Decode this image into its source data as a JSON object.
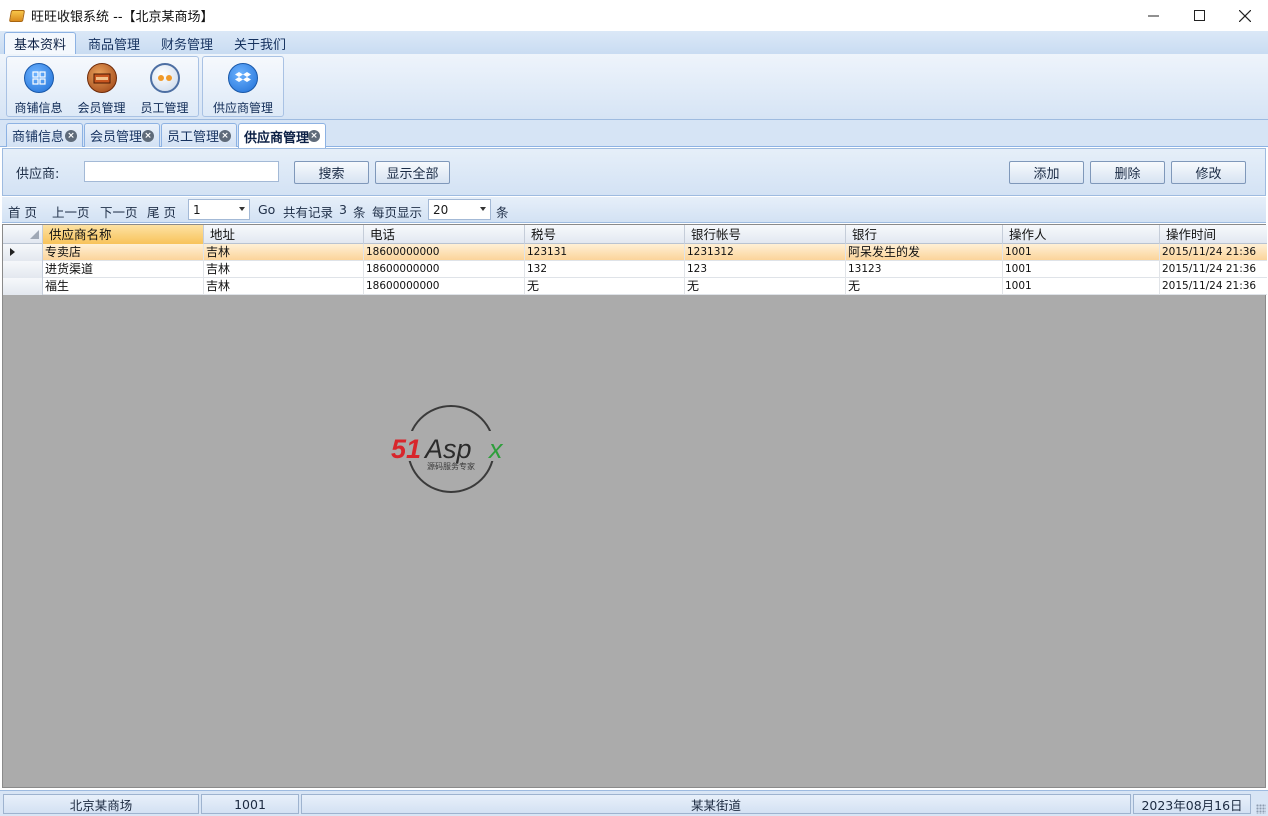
{
  "window": {
    "title": "旺旺收银系统 --【北京某商场】"
  },
  "menu": {
    "tabs": [
      "基本资料",
      "商品管理",
      "财务管理",
      "关于我们"
    ]
  },
  "ribbon": {
    "buttons": [
      "商铺信息",
      "会员管理",
      "员工管理",
      "供应商管理"
    ]
  },
  "doc_tabs": [
    "商铺信息",
    "会员管理",
    "员工管理",
    "供应商管理"
  ],
  "search": {
    "label": "供应商:",
    "value": "",
    "search_button": "搜索",
    "show_all_button": "显示全部",
    "add_button": "添加",
    "delete_button": "删除",
    "edit_button": "修改"
  },
  "pager": {
    "first": "首 页",
    "prev": "上一页",
    "next": "下一页",
    "last": "尾 页",
    "page_value": "1",
    "go": "Go",
    "total_label": "共有记录",
    "total_count": "3",
    "unit": "条",
    "per_page_label": "每页显示",
    "per_page_value": "20",
    "unit2": "条"
  },
  "grid": {
    "columns": [
      "供应商名称",
      "地址",
      "电话",
      "税号",
      "银行帐号",
      "银行",
      "操作人",
      "操作时间"
    ],
    "rows": [
      [
        "专卖店",
        "吉林",
        "18600000000",
        "123131",
        "1231312",
        "阿呆发生的发",
        "1001",
        "2015/11/24 21:36"
      ],
      [
        "进货渠道",
        "吉林",
        "18600000000",
        "132",
        "123",
        "13123",
        "1001",
        "2015/11/24 21:36"
      ],
      [
        "福生",
        "吉林",
        "18600000000",
        "无",
        "无",
        "无",
        "1001",
        "2015/11/24 21:36"
      ]
    ]
  },
  "watermark": {
    "brand": "51Aspx",
    "tagline": "源码服务专家"
  },
  "status": {
    "store": "北京某商场",
    "user": "1001",
    "address": "某某街道",
    "date": "2023年08月16日"
  },
  "colors": {
    "accent": "#8db2e3",
    "selected_row": "#fbd49a",
    "grid_background": "#ababab"
  }
}
